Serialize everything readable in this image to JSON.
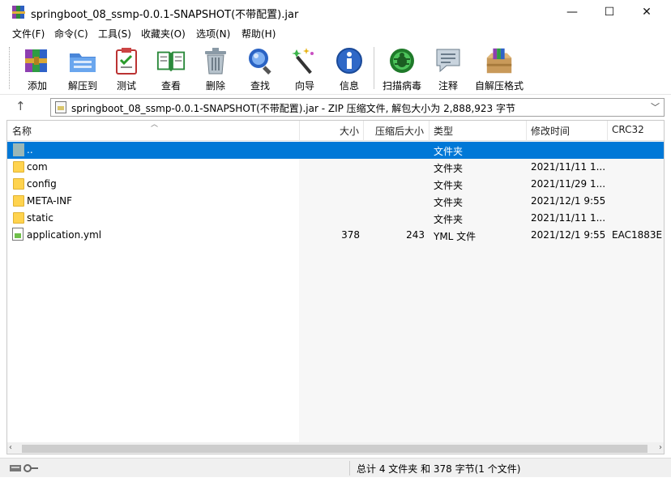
{
  "window": {
    "title": "springboot_08_ssmp-0.0.1-SNAPSHOT(不带配置).jar",
    "minimize_glyph": "—",
    "maximize_glyph": "☐",
    "close_glyph": "✕"
  },
  "menu": {
    "items": [
      "文件(F)",
      "命令(C)",
      "工具(S)",
      "收藏夹(O)",
      "选项(N)",
      "帮助(H)"
    ]
  },
  "toolbar": {
    "buttons": [
      {
        "label": "添加",
        "icon": "add-icon"
      },
      {
        "label": "解压到",
        "icon": "extract-to-icon"
      },
      {
        "label": "测试",
        "icon": "test-icon"
      },
      {
        "label": "查看",
        "icon": "view-icon"
      },
      {
        "label": "删除",
        "icon": "delete-icon"
      },
      {
        "label": "查找",
        "icon": "find-icon"
      },
      {
        "label": "向导",
        "icon": "wizard-icon"
      },
      {
        "label": "信息",
        "icon": "info-icon"
      },
      {
        "label": "扫描病毒",
        "icon": "virus-scan-icon"
      },
      {
        "label": "注释",
        "icon": "comment-icon"
      },
      {
        "label": "自解压格式",
        "icon": "sfx-icon"
      }
    ]
  },
  "address": {
    "up_glyph": "↑",
    "path": "springboot_08_ssmp-0.0.1-SNAPSHOT(不带配置).jar - ZIP 压缩文件, 解包大小为 2,888,923 字节",
    "dropdown_glyph": "﹀"
  },
  "columns": {
    "name": "名称",
    "size": "大小",
    "packed": "压缩后大小",
    "type": "类型",
    "modified": "修改时间",
    "crc": "CRC32"
  },
  "files": [
    {
      "name": "..",
      "size": "",
      "packed": "",
      "type": "文件夹",
      "modified": "",
      "crc": "",
      "kind": "up",
      "selected": true
    },
    {
      "name": "com",
      "size": "",
      "packed": "",
      "type": "文件夹",
      "modified": "2021/11/11 1...",
      "crc": "",
      "kind": "folder"
    },
    {
      "name": "config",
      "size": "",
      "packed": "",
      "type": "文件夹",
      "modified": "2021/11/29 1...",
      "crc": "",
      "kind": "folder"
    },
    {
      "name": "META-INF",
      "size": "",
      "packed": "",
      "type": "文件夹",
      "modified": "2021/12/1 9:55",
      "crc": "",
      "kind": "folder"
    },
    {
      "name": "static",
      "size": "",
      "packed": "",
      "type": "文件夹",
      "modified": "2021/11/11 1...",
      "crc": "",
      "kind": "folder"
    },
    {
      "name": "application.yml",
      "size": "378",
      "packed": "243",
      "type": "YML 文件",
      "modified": "2021/12/1 9:55",
      "crc": "EAC1883E",
      "kind": "yml"
    }
  ],
  "scroll": {
    "left_glyph": "‹",
    "right_glyph": "›"
  },
  "status": {
    "text": "总计 4 文件夹 和 378 字节(1 个文件)"
  },
  "colors": {
    "selection": "#0078d7",
    "folder": "#ffd34e"
  }
}
